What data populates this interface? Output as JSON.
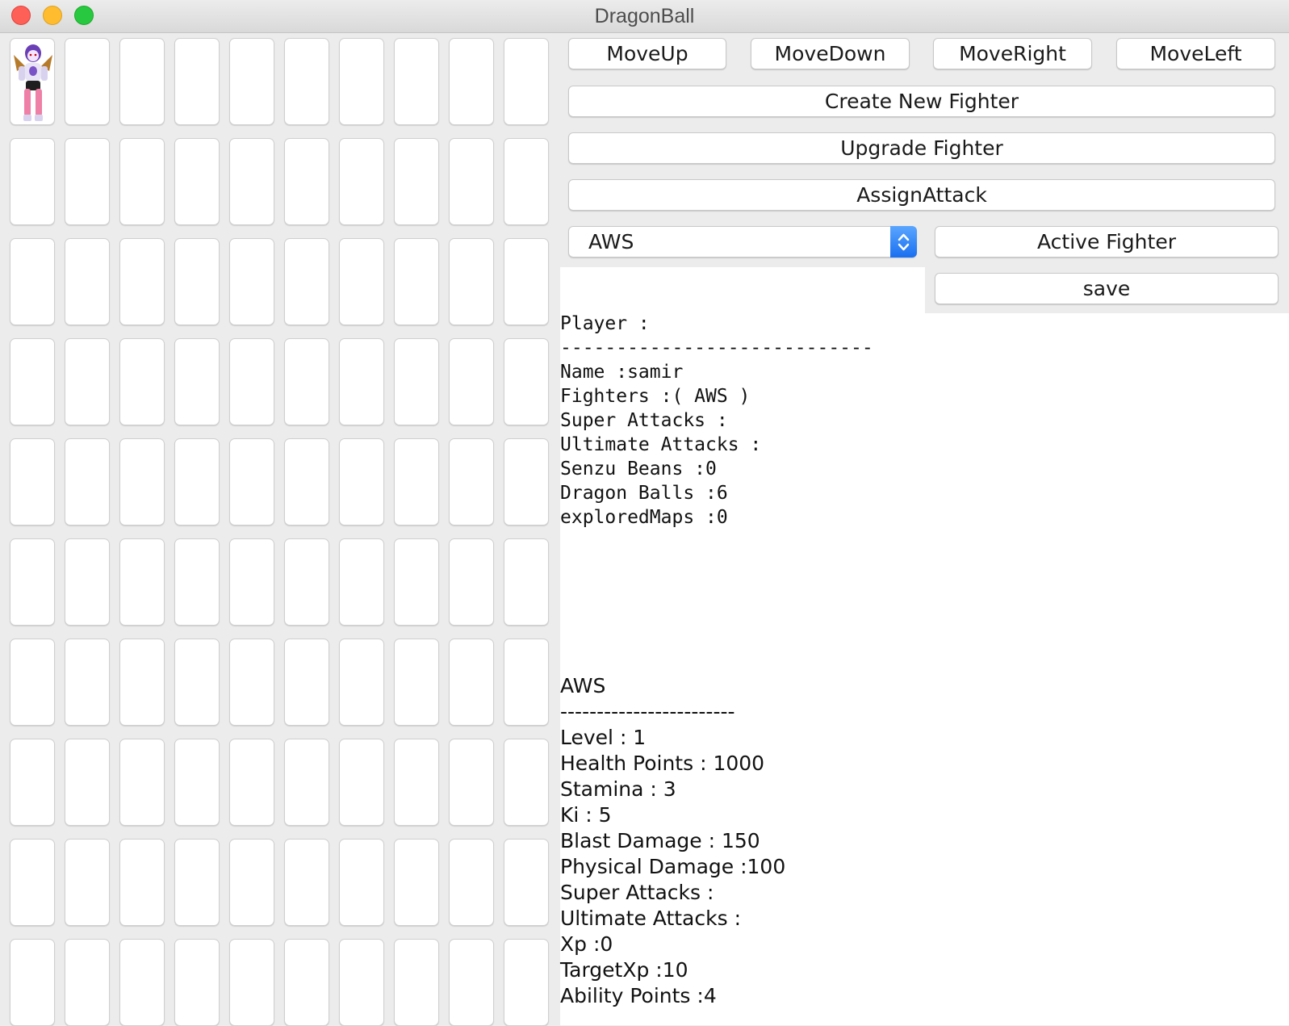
{
  "window": {
    "title": "DragonBall"
  },
  "grid": {
    "rows": 10,
    "cols": 10,
    "fighter_cell": {
      "row": 0,
      "col": 0,
      "icon": "frieza-sprite"
    }
  },
  "controls": {
    "move_up": "MoveUp",
    "move_down": "MoveDown",
    "move_right": "MoveRight",
    "move_left": "MoveLeft",
    "create_fighter": "Create New Fighter",
    "upgrade_fighter": "Upgrade Fighter",
    "assign_attack": "AssignAttack",
    "fighter_select": {
      "value": "AWS"
    },
    "active_fighter": "Active Fighter",
    "save": "save"
  },
  "player": {
    "header": "Player :",
    "divider": "----------------------------",
    "name": "Name :samir",
    "fighters": "Fighters :( AWS )",
    "super_attacks": "Super Attacks :",
    "ultimate_attacks": "Ultimate Attacks :",
    "senzu_beans": "Senzu Beans :0",
    "dragon_balls": "Dragon Balls :6",
    "explored_maps": "exploredMaps :0"
  },
  "fighter": {
    "name": "AWS",
    "divider": "------------------------",
    "level": "Level : 1",
    "health": "Health Points : 1000",
    "stamina": "Stamina : 3",
    "ki": "Ki : 5",
    "blast_damage": "Blast Damage : 150",
    "physical_damage": "Physical Damage :100",
    "super_attacks": "Super Attacks :",
    "ultimate_attacks": "Ultimate Attacks :",
    "xp": "Xp :0",
    "target_xp": "TargetXp :10",
    "ability_points": "Ability Points :4"
  }
}
